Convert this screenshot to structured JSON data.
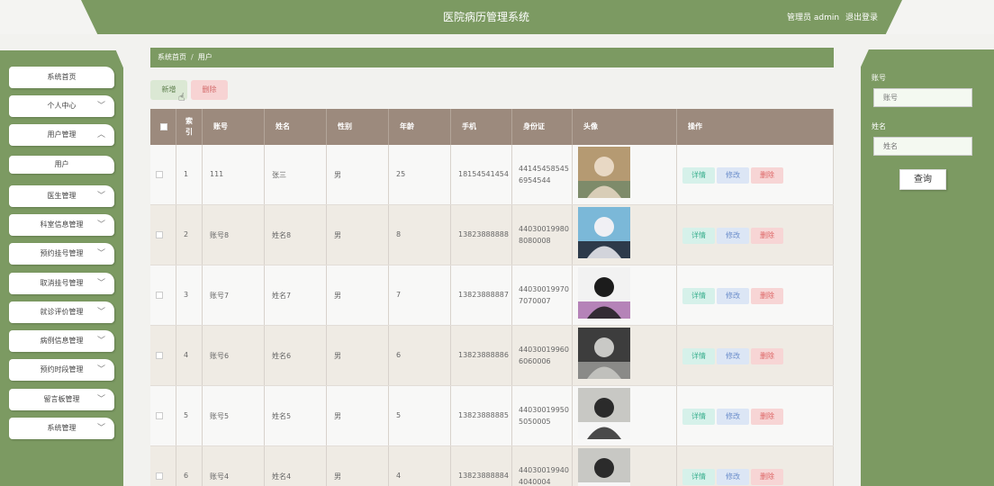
{
  "header": {
    "title": "医院病历管理系统",
    "user_label": "管理员 admin",
    "logout": "退出登录"
  },
  "sidebar": {
    "items": [
      {
        "label": "系统首页",
        "chevron": ""
      },
      {
        "label": "个人中心",
        "chevron": "chevron-down"
      },
      {
        "label": "用户管理",
        "chevron": "chevron-up"
      },
      {
        "label": "用户",
        "chevron": ""
      },
      {
        "label": "医生管理",
        "chevron": "chevron-down"
      },
      {
        "label": "科室信息管理",
        "chevron": "chevron-down"
      },
      {
        "label": "预约挂号管理",
        "chevron": "chevron-down"
      },
      {
        "label": "取消挂号管理",
        "chevron": "chevron-down"
      },
      {
        "label": "就诊评价管理",
        "chevron": "chevron-down"
      },
      {
        "label": "病例信息管理",
        "chevron": "chevron-down"
      },
      {
        "label": "预约时段管理",
        "chevron": "chevron-down"
      },
      {
        "label": "留言板管理",
        "chevron": "chevron-down"
      },
      {
        "label": "系统管理",
        "chevron": "chevron-down"
      }
    ]
  },
  "breadcrumb": {
    "home": "系统首页",
    "separator": "/",
    "current": "用户"
  },
  "toolbar": {
    "add": "新增",
    "delete": "删除"
  },
  "table": {
    "columns": [
      "",
      "索引",
      "账号",
      "姓名",
      "性别",
      "年龄",
      "手机",
      "身份证",
      "头像",
      "操作"
    ],
    "rows": [
      {
        "index": "1",
        "account": "111",
        "name": "张三",
        "gender": "男",
        "age": "25",
        "phone": "18154541454",
        "id_card": "441454585456954544"
      },
      {
        "index": "2",
        "account": "账号8",
        "name": "姓名8",
        "gender": "男",
        "age": "8",
        "phone": "13823888888",
        "id_card": "440300199808080008"
      },
      {
        "index": "3",
        "account": "账号7",
        "name": "姓名7",
        "gender": "男",
        "age": "7",
        "phone": "13823888887",
        "id_card": "440300199707070007"
      },
      {
        "index": "4",
        "account": "账号6",
        "name": "姓名6",
        "gender": "男",
        "age": "6",
        "phone": "13823888886",
        "id_card": "440300199606060006"
      },
      {
        "index": "5",
        "account": "账号5",
        "name": "姓名5",
        "gender": "男",
        "age": "5",
        "phone": "13823888885",
        "id_card": "440300199505050005"
      },
      {
        "index": "6",
        "account": "账号4",
        "name": "姓名4",
        "gender": "男",
        "age": "4",
        "phone": "13823888884",
        "id_card": "440300199404040004"
      }
    ],
    "actions": {
      "view": "详情",
      "edit": "修改",
      "delete": "删除"
    }
  },
  "search": {
    "account_label": "账号",
    "account_placeholder": "账号",
    "name_label": "姓名",
    "name_placeholder": "姓名",
    "button": "查询"
  },
  "colors": {
    "accent": "#7c9a62",
    "table_header": "#9c8a7d"
  }
}
